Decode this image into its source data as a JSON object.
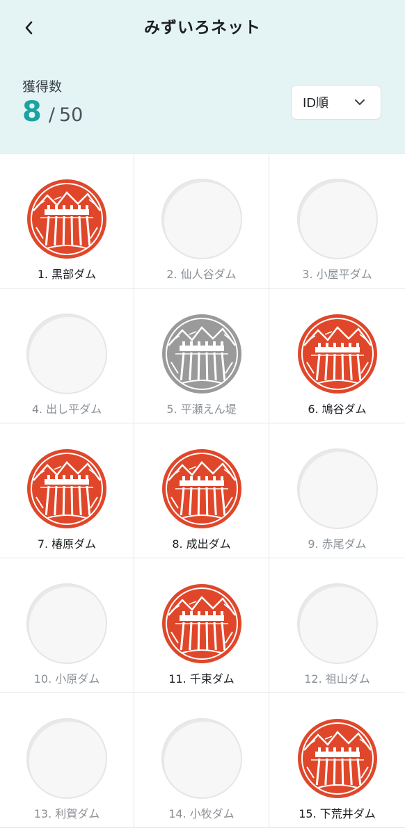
{
  "header": {
    "title": "みずいろネット",
    "count_label": "獲得数",
    "count_value": "8",
    "count_separator": "/",
    "count_total": "50",
    "sort_label": "ID順",
    "back_icon": "chevron-left-icon",
    "sort_icon": "chevron-down-icon"
  },
  "colors": {
    "accent": "#1aa3a0",
    "stamp_red": "#e0472a",
    "stamp_gray": "#9a9a9a",
    "header_bg": "#e4f4f5"
  },
  "dams": [
    {
      "label": "1. 黒部ダム",
      "state": "obtained"
    },
    {
      "label": "2. 仙人谷ダム",
      "state": "empty"
    },
    {
      "label": "3. 小屋平ダム",
      "state": "empty"
    },
    {
      "label": "4. 出し平ダム",
      "state": "empty"
    },
    {
      "label": "5. 平瀬えん堤",
      "state": "gray"
    },
    {
      "label": "6. 鳩谷ダム",
      "state": "obtained"
    },
    {
      "label": "7. 椿原ダム",
      "state": "obtained"
    },
    {
      "label": "8. 成出ダム",
      "state": "obtained"
    },
    {
      "label": "9. 赤尾ダム",
      "state": "empty"
    },
    {
      "label": "10. 小原ダム",
      "state": "empty"
    },
    {
      "label": "11. 千束ダム",
      "state": "obtained"
    },
    {
      "label": "12. 祖山ダム",
      "state": "empty"
    },
    {
      "label": "13. 利賀ダム",
      "state": "empty"
    },
    {
      "label": "14. 小牧ダム",
      "state": "empty"
    },
    {
      "label": "15. 下荒井ダム",
      "state": "obtained"
    }
  ]
}
